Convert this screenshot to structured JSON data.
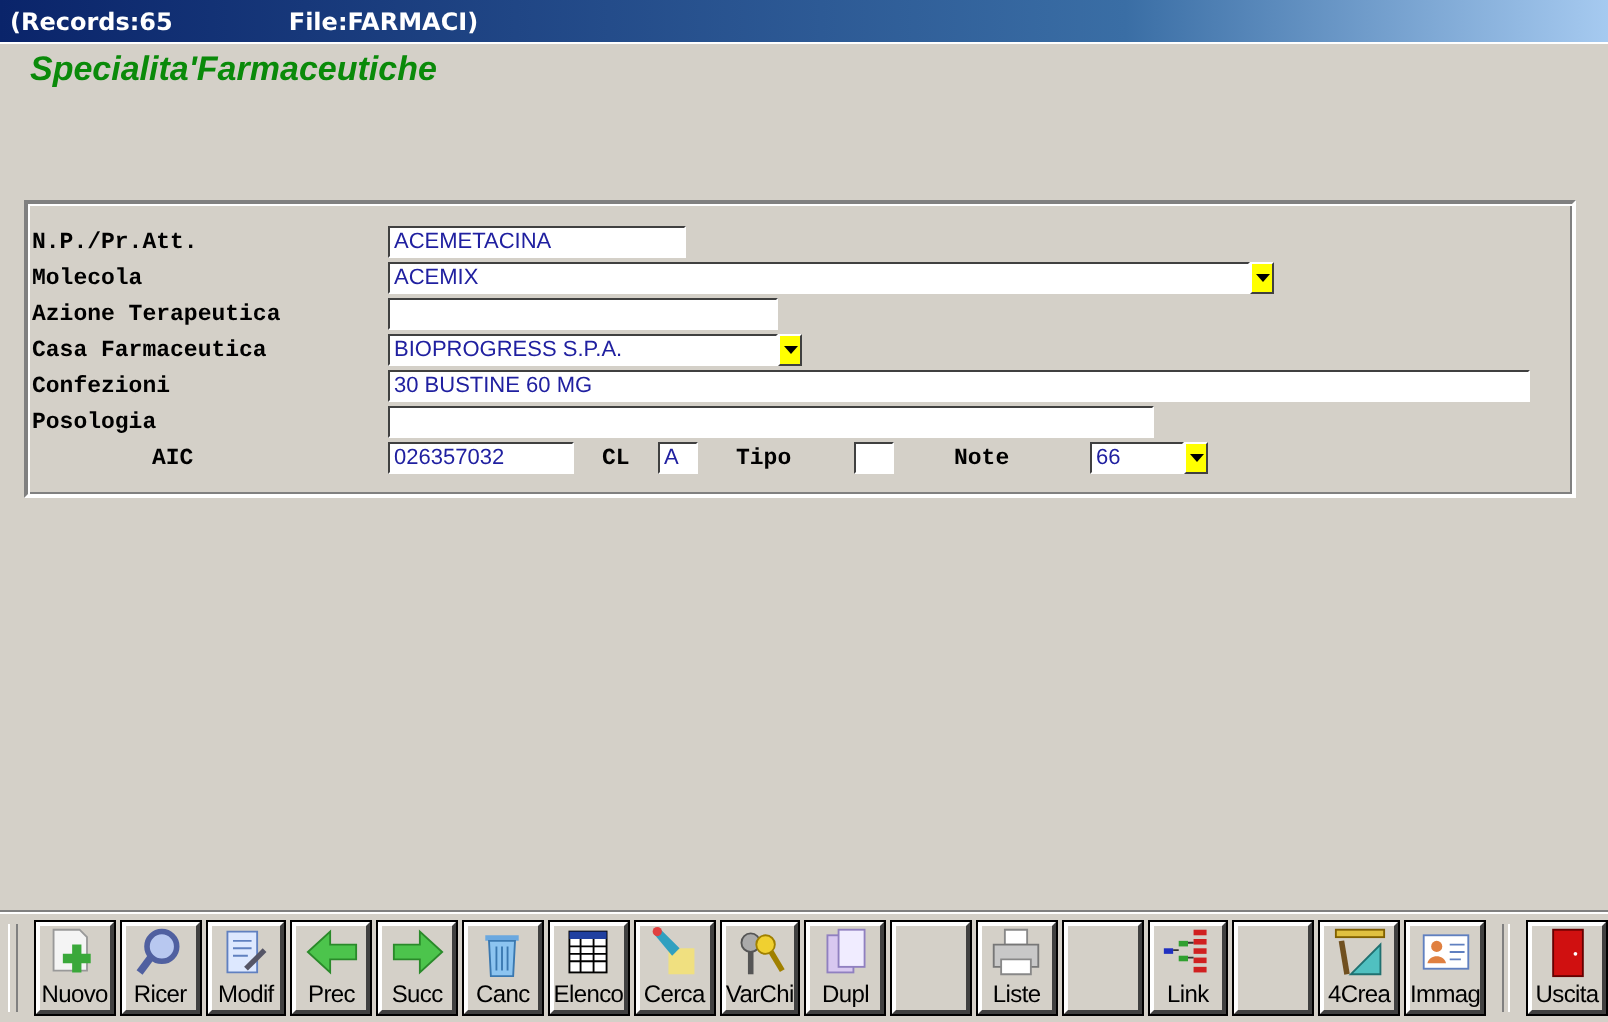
{
  "window": {
    "records": "(Records:65",
    "file": "File:FARMACI)"
  },
  "heading": "Specialita'Farmaceutiche",
  "form": {
    "fields": [
      {
        "label": "N.P./Pr.Att.",
        "value": "ACEMETACINA",
        "kind": "text"
      },
      {
        "label": "Molecola",
        "value": "ACEMIX",
        "kind": "combo"
      },
      {
        "label": "Azione Terapeutica",
        "kind": "text"
      },
      {
        "label": "Casa Farmaceutica",
        "value": "BIOPROGRESS S.P.A.",
        "kind": "combo"
      },
      {
        "label": "Confezioni",
        "value": "30 BUSTINE 60 MG",
        "kind": "text"
      },
      {
        "label": "Posologia",
        "kind": "text"
      }
    ],
    "code_row": [
      {
        "label": "AIC",
        "value": "026357032",
        "kind": "text"
      },
      {
        "label": "CL",
        "value": "A",
        "kind": "text"
      },
      {
        "label": "Tipo",
        "kind": "text"
      },
      {
        "label": "Note",
        "value": "66",
        "kind": "combo"
      }
    ]
  },
  "toolbar": [
    {
      "kind": "button",
      "label": "Nuovo"
    },
    {
      "kind": "button",
      "label": "Ricer"
    },
    {
      "kind": "button",
      "label": "Modif"
    },
    {
      "kind": "button",
      "label": "Prec"
    },
    {
      "kind": "button",
      "label": "Succ"
    },
    {
      "kind": "button",
      "label": "Canc"
    },
    {
      "kind": "button",
      "label": "Elenco"
    },
    {
      "kind": "button",
      "label": "Cerca"
    },
    {
      "kind": "button",
      "label": "VarChi"
    },
    {
      "kind": "button",
      "label": "Dupl"
    },
    {
      "kind": "blank"
    },
    {
      "kind": "button",
      "label": "Liste"
    },
    {
      "kind": "blank"
    },
    {
      "kind": "button",
      "label": "Link"
    },
    {
      "kind": "blank"
    },
    {
      "kind": "button",
      "label": "4Crea"
    },
    {
      "kind": "button",
      "label": "Immag"
    },
    {
      "kind": "separator"
    },
    {
      "kind": "button",
      "label": "Uscita"
    }
  ]
}
